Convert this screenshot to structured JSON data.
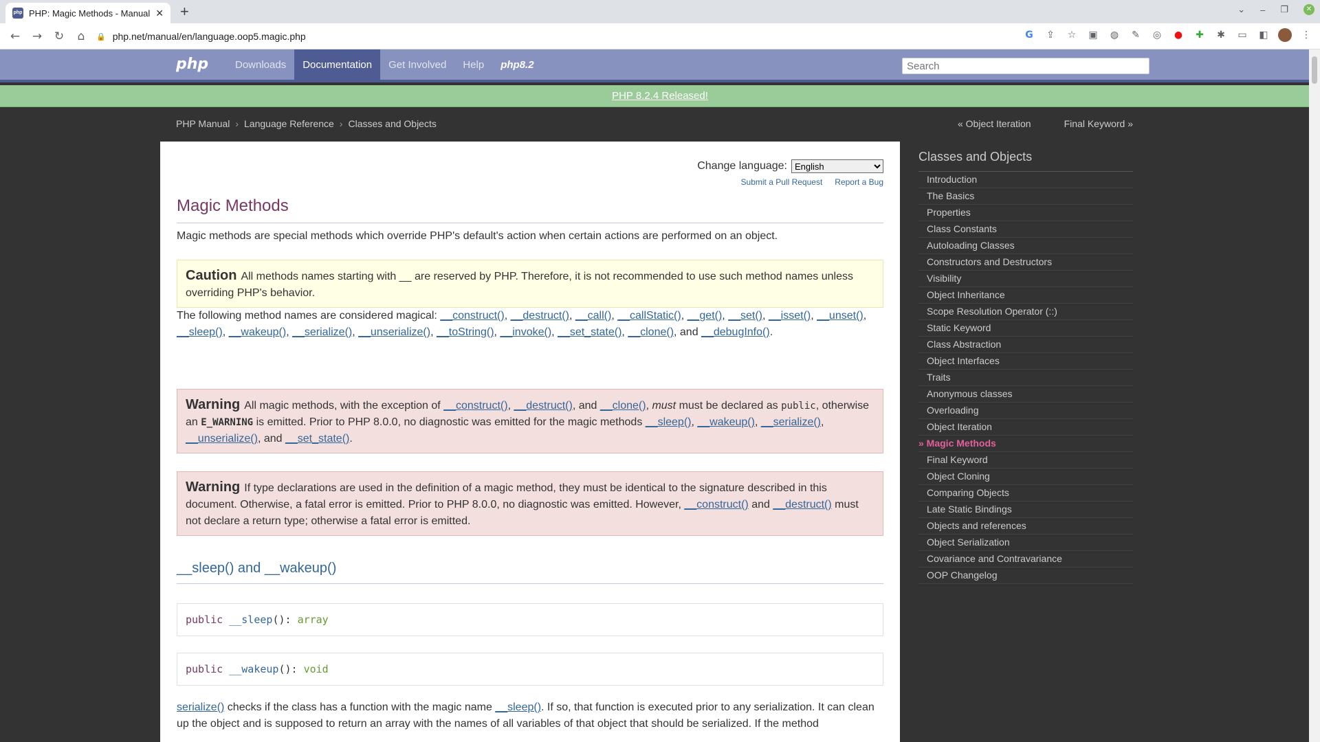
{
  "browser": {
    "tab_title": "PHP: Magic Methods - Manual",
    "url": "php.net/manual/en/language.oop5.magic.php"
  },
  "header": {
    "logo": "php",
    "nav": [
      "Downloads",
      "Documentation",
      "Get Involved",
      "Help"
    ],
    "active_nav": "Documentation",
    "version_link": "php8.2",
    "search_placeholder": "Search"
  },
  "banner": "PHP 8.2.4 Released!",
  "breadcrumb": [
    "PHP Manual",
    "Language Reference",
    "Classes and Objects"
  ],
  "prev_link": "« Object Iteration",
  "next_link": "Final Keyword »",
  "content": {
    "change_language_label": "Change language:",
    "language_selected": "English",
    "submit_pr": "Submit a Pull Request",
    "report_bug": "Report a Bug",
    "title": "Magic Methods",
    "intro": "Magic methods are special methods which override PHP's default's action when certain actions are performed on an object.",
    "caution_head": "Caution",
    "caution_text": "All methods names starting with __ are reserved by PHP. Therefore, it is not recommended to use such method names unless overriding PHP's behavior.",
    "magical_intro": "The following method names are considered magical:",
    "magical_methods": [
      "__construct()",
      "__destruct()",
      "__call()",
      "__callStatic()",
      "__get()",
      "__set()",
      "__isset()",
      "__unset()",
      "__sleep()",
      "__wakeup()",
      "__serialize()",
      "__unserialize()",
      "__toString()",
      "__invoke()",
      "__set_state()",
      "__clone()",
      "__debugInfo()"
    ],
    "warning1_head": "Warning",
    "warning1_a": "All magic methods, with the exception of",
    "warning1_b": "must be declared as",
    "warning1_public": "public",
    "warning1_c": ", otherwise an",
    "warning1_ewarning": "E_WARNING",
    "warning1_d": "is emitted. Prior to PHP 8.0.0, no diagnostic was emitted for the magic methods",
    "warning2_head": "Warning",
    "warning2_a": "If type declarations are used in the definition of a magic method, they must be identical to the signature described in this document. Otherwise, a fatal error is emitted. Prior to PHP 8.0.0, no diagnostic was emitted. However,",
    "warning2_b": "must not declare a return type; otherwise a fatal error is emitted.",
    "section_title": "__sleep() and __wakeup()",
    "sig1": {
      "kw": "public",
      "fn": "__sleep",
      "args": "()",
      "ret": ": ",
      "type": "array"
    },
    "sig2": {
      "kw": "public",
      "fn": "__wakeup",
      "args": "()",
      "ret": ": ",
      "type": "void"
    },
    "serialize_link": "serialize()",
    "serialize_text_a": "checks if the class has a function with the magic name",
    "serialize_text_b": ". If so, that function is executed prior to any serialization. It can clean up the object and is supposed to return an array with the names of all variables of that object that should be serialized. If the method"
  },
  "sidebar": {
    "title": "Classes and Objects",
    "items": [
      "Introduction",
      "The Basics",
      "Properties",
      "Class Constants",
      "Autoloading Classes",
      "Constructors and Destructors",
      "Visibility",
      "Object Inheritance",
      "Scope Resolution Operator (::)",
      "Static Keyword",
      "Class Abstraction",
      "Object Interfaces",
      "Traits",
      "Anonymous classes",
      "Overloading",
      "Object Iteration",
      "» Magic Methods",
      "Final Keyword",
      "Object Cloning",
      "Comparing Objects",
      "Late Static Bindings",
      "Objects and references",
      "Object Serialization",
      "Covariance and Contravariance",
      "OOP Changelog"
    ],
    "current_index": 16
  }
}
